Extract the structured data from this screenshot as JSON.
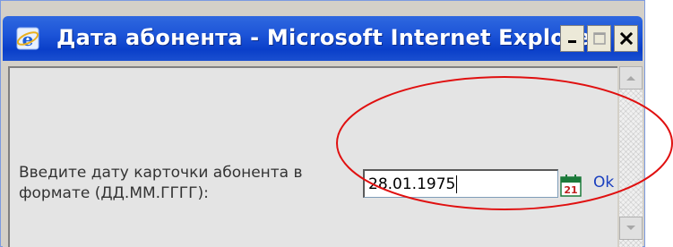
{
  "window": {
    "title": "Дата абонента - Microsoft Internet Explorer",
    "minimize_label": "_",
    "maximize_label": "□",
    "close_label": "×"
  },
  "form": {
    "prompt": "Введите дату карточки абонента в формате (ДД.ММ.ГГГГ):",
    "date_value": "28.01.1975",
    "calendar_day": "21",
    "ok_label": "Ok"
  },
  "icons": {
    "title": "ie-logo-icon",
    "calendar": "calendar-icon"
  },
  "colors": {
    "titlebar": "#0a3fc9",
    "annotation_ellipse": "#e01010",
    "link": "#1a3fbf"
  }
}
